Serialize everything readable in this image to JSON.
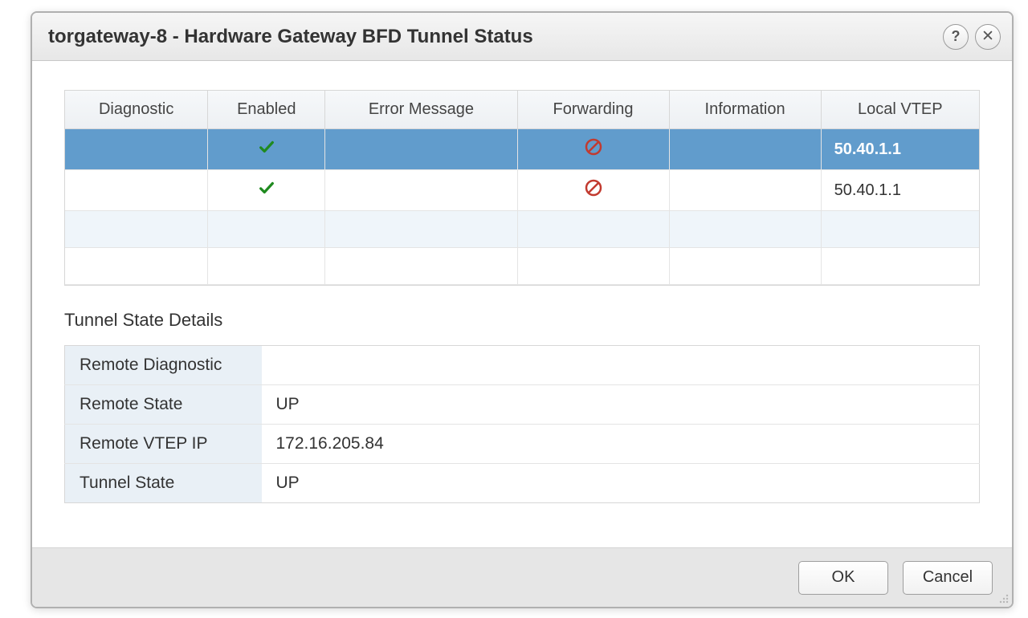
{
  "dialog": {
    "title": "torgateway-8 - Hardware Gateway BFD Tunnel Status"
  },
  "grid": {
    "columns": [
      "Diagnostic",
      "Enabled",
      "Error Message",
      "Forwarding",
      "Information",
      "Local VTEP"
    ],
    "rows": [
      {
        "diagnostic": "",
        "enabled": true,
        "error_message": "",
        "forwarding": false,
        "information": "",
        "local_vtep": "50.40.1.1",
        "selected": true
      },
      {
        "diagnostic": "",
        "enabled": true,
        "error_message": "",
        "forwarding": false,
        "information": "",
        "local_vtep": "50.40.1.1",
        "selected": false
      }
    ]
  },
  "details_section_title": "Tunnel State Details",
  "details": {
    "rows": [
      {
        "label": "Remote Diagnostic",
        "value": ""
      },
      {
        "label": "Remote State",
        "value": "UP"
      },
      {
        "label": "Remote VTEP IP",
        "value": "172.16.205.84"
      },
      {
        "label": "Tunnel State",
        "value": "UP"
      }
    ]
  },
  "buttons": {
    "ok": "OK",
    "cancel": "Cancel"
  }
}
